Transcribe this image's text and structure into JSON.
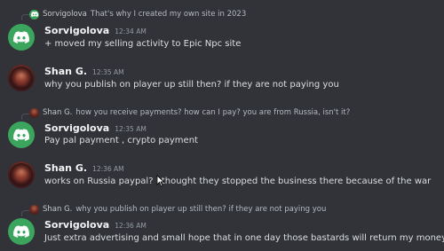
{
  "messages": [
    {
      "reply": {
        "author": "Sorvigolova",
        "text": "That's why I created my own site in 2023",
        "avatar": "discord-logo-icon"
      },
      "author": "Sorvigolova",
      "time": "12:34 AM",
      "avatar": "discord-logo-icon",
      "text": "+ moved my selling activity to Epic Npc site"
    },
    {
      "author": "Shan G.",
      "time": "12:35 AM",
      "avatar": "user-avatar",
      "text": "why you publish on player up still then? if they are not paying you"
    },
    {
      "reply": {
        "author": "Shan G.",
        "text": "how you receive payments? how can I pay? you are from Russia, isn't it?",
        "avatar": "user-avatar"
      },
      "author": "Sorvigolova",
      "time": "12:35 AM",
      "avatar": "discord-logo-icon",
      "text": "Pay pal payment , crypto payment"
    },
    {
      "author": "Shan G.",
      "time": "12:36 AM",
      "avatar": "user-avatar",
      "text": "works on Russia paypal? I thought they stopped the business there because of the war"
    },
    {
      "reply": {
        "author": "Shan G.",
        "text": "why you publish on player up still then? if they are not paying you",
        "avatar": "user-avatar"
      },
      "author": "Sorvigolova",
      "time": "12:36 AM",
      "avatar": "discord-logo-icon",
      "text": "Just extra advertising and small hope that in one day those bastards will return my money"
    }
  ],
  "colors": {
    "background": "#313338",
    "discord_green": "#3ba55d",
    "author": "#f2f3f5",
    "timestamp": "#949ba4",
    "text": "#dbdee1"
  }
}
